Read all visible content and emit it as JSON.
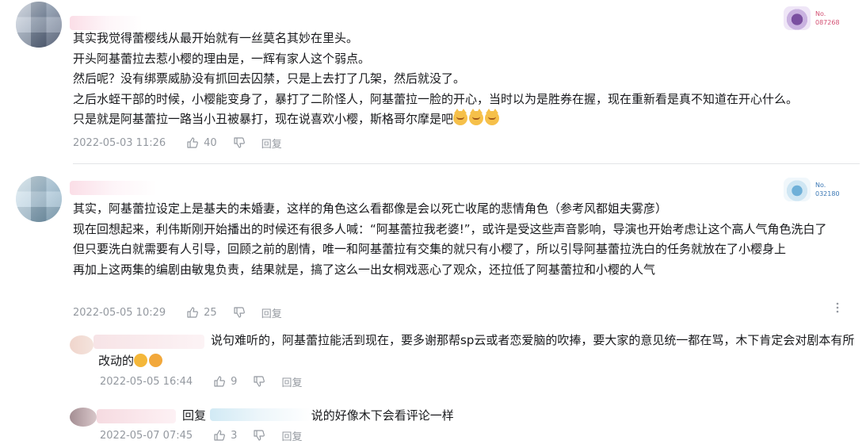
{
  "comments": [
    {
      "badge_no": "No.\n087268",
      "lines": [
        "其实我觉得蕾樱线从最开始就有一丝莫名其妙在里头。",
        "开头阿基蕾拉去惹小樱的理由是，一辉有家人这个弱点。",
        "然后呢？没有绑票威胁没有抓回去囚禁，只是上去打了几架，然后就没了。",
        "之后水蛭干部的时候，小樱能变身了，暴打了二阶怪人，阿基蕾拉一脸的开心，当时以为是胜券在握，现在重新看是真不知道在开心什么。",
        "只是就是阿基蕾拉一路当小丑被暴打，现在说喜欢小樱，斯格哥尔摩是吧"
      ],
      "time": "2022-05-03 11:26",
      "likes": "40",
      "reply_label": "回复"
    },
    {
      "badge_no": "No.\n032180",
      "lines": [
        "其实，阿基蕾拉设定上是基夫的未婚妻，这样的角色这么看都像是会以死亡收尾的悲情角色（参考风都姐夫雾彦）",
        "现在回想起来，利伟斯刚开始播出的时候还有很多人喊：“阿基蕾拉我老婆!”，或许是受这些声音影响，导演也开始考虑让这个高人气角色洗白了",
        "但只要洗白就需要有人引导，回顾之前的剧情，唯一和阿基蕾拉有交集的就只有小樱了，所以引导阿基蕾拉洗白的任务就放在了小樱身上",
        "再加上这两集的编剧由敏鬼负责，结果就是，搞了这么一出女桐戏恶心了观众，还拉低了阿基蕾拉和小樱的人气"
      ],
      "time": "2022-05-05 10:29",
      "likes": "25",
      "reply_label": "回复"
    }
  ],
  "replies": [
    {
      "text": "说句难听的，阿基蕾拉能活到现在，要多谢那帮sp云或者恋爱脑的吹捧，要大家的意见统一都在骂，木下肯定会对剧本有所改动的",
      "time": "2022-05-05 16:44",
      "likes": "9",
      "reply_label": "回复"
    },
    {
      "prefix": "回复",
      "text": "说的好像木下会看评论一样",
      "time": "2022-05-07 07:45",
      "likes": "3",
      "reply_label": "回复"
    }
  ],
  "icons": {
    "like": "thumbs-up-icon",
    "dislike": "thumbs-down-icon",
    "more": "more-vertical-icon"
  }
}
